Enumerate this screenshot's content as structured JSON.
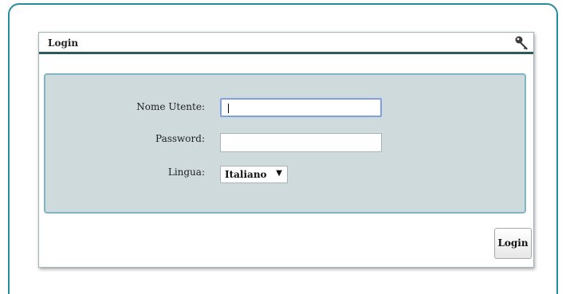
{
  "panel": {
    "title": "Login",
    "icon": "key-icon"
  },
  "form": {
    "username_label": "Nome Utente:",
    "username_value": "",
    "password_label": "Password:",
    "password_value": "",
    "language_label": "Lingua:",
    "language_selected": "Italiano"
  },
  "actions": {
    "login_label": "Login"
  },
  "colors": {
    "frame_border": "#2a8a9e",
    "form_background": "#cfdadc",
    "form_border": "#7fb6c1",
    "header_rule": "#2e5960",
    "focus_border": "#7f9fe0"
  }
}
